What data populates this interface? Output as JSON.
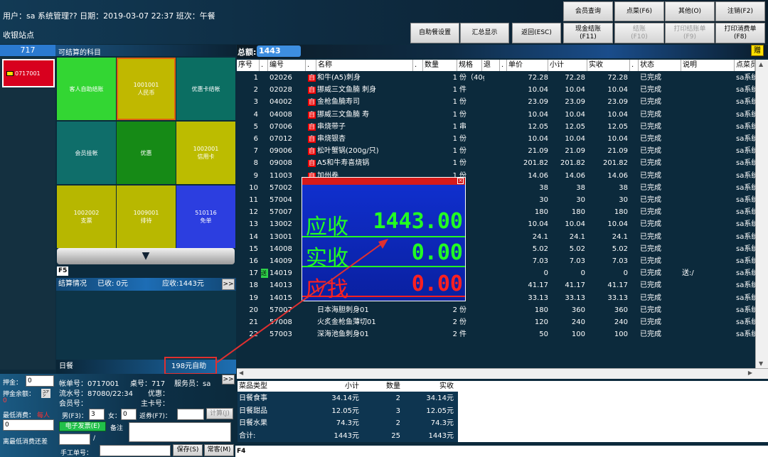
{
  "topbar": {
    "user_line": "用户：sa 系统管理?? 日期：2019-03-07 22:37 班次：午餐",
    "station": "收银站点",
    "row1": [
      "会员查询",
      "点菜(F6)",
      "其他(O)",
      "注销(F2)"
    ],
    "row2": [
      {
        "label": "自助餐设置",
        "sub": "",
        "disabled": false
      },
      {
        "label": "汇总显示",
        "sub": "",
        "disabled": false
      },
      {
        "label": "返回(ESC)",
        "sub": "",
        "disabled": false
      },
      {
        "label": "现金结账",
        "sub": "(F11)",
        "disabled": false
      },
      {
        "label": "结账",
        "sub": "(F10)",
        "disabled": true
      },
      {
        "label": "打印结账单",
        "sub": "(F9)",
        "disabled": true
      },
      {
        "label": "打印消费单",
        "sub": "(F8)",
        "disabled": false
      }
    ]
  },
  "left": {
    "table_count": "717",
    "subjects_label": "可结算的科目",
    "table_card": "0717001",
    "tiles": [
      {
        "code": "",
        "name": "客人自助结账",
        "color": "#33d633"
      },
      {
        "code": "1001001",
        "name": "人民币",
        "color": "#c0b800"
      },
      {
        "code": "",
        "name": "优惠卡结帐",
        "color": "#0b6e62"
      },
      {
        "code": "",
        "name": "会员挂帐",
        "color": "#0f6e6a"
      },
      {
        "code": "",
        "name": "优惠",
        "color": "#168a16"
      },
      {
        "code": "1002001",
        "name": "信用卡",
        "color": "#bcbc00"
      },
      {
        "code": "1002002",
        "name": "支票",
        "color": "#b7b700"
      },
      {
        "code": "1009001",
        "name": "排待",
        "color": "#b8b800"
      },
      {
        "code": "510116",
        "name": "免单",
        "color": "#2c3ee0"
      }
    ],
    "f5": "F5",
    "settle_title": "结算情况",
    "settle_received": "已收: 0元",
    "settle_due": "应收:1443元",
    "more": ">>",
    "meal": "日餐",
    "meal_box": "198元自助"
  },
  "info": {
    "deposit_label": "押金：",
    "deposit_value": "0",
    "deposit_balance_label": "押金余额：",
    "deposit_balance_value": "0",
    "min_spend_label": "最低消费：",
    "min_spend_tag": "每人",
    "min_spend_value": "0",
    "distance_label": "离最低消费还差",
    "account_no": "帐单号：0717001",
    "table_no": "桌号：717",
    "waiter": "服务员：sa",
    "serial_no": "流水号：87080/22:34",
    "discount": "优惠：",
    "member_no": "会员号：",
    "main_card": "主卡号：",
    "male_label": "男(F3)：",
    "male_value": "3",
    "female_label": "女：",
    "female_value": "0",
    "voucher_label": "返券(F7)：",
    "calc_btn": "计算(J)",
    "einvoice_btn": "电子发票(E)",
    "remark_label": "备注",
    "slash": "/",
    "manual_label": "手工单号：",
    "save_btn": "保存(S)",
    "common_btn": "常客(M)",
    "more": ">>"
  },
  "main": {
    "total_label": "总额:",
    "total_value": "1443",
    "gift_btn": "赠",
    "columns": [
      "序号",
      ".",
      "编号",
      ".",
      "名称",
      ".",
      "数量",
      "规格",
      "退",
      ".",
      "单价",
      "小计",
      "实收",
      ".",
      "状态",
      "说明",
      "点菜员"
    ],
    "rows": [
      {
        "no": "1",
        "code": "02026",
        "zi": true,
        "name": "和牛(A5)刺身",
        "qty": "1",
        "spec": "份（40g",
        "price": "72.28",
        "sub": "72.28",
        "real": "72.28",
        "status": "已完成",
        "note": "",
        "staff": "sa系统"
      },
      {
        "no": "2",
        "code": "02028",
        "zi": true,
        "name": "挪威三文鱼腩 刺身",
        "qty": "1",
        "spec": "件",
        "price": "10.04",
        "sub": "10.04",
        "real": "10.04",
        "status": "已完成",
        "note": "",
        "staff": "sa系统"
      },
      {
        "no": "3",
        "code": "04002",
        "zi": true,
        "name": "金枪鱼腩寿司",
        "qty": "1",
        "spec": "份",
        "price": "23.09",
        "sub": "23.09",
        "real": "23.09",
        "status": "已完成",
        "note": "",
        "staff": "sa系统"
      },
      {
        "no": "4",
        "code": "04008",
        "zi": true,
        "name": "挪威三文鱼腩 寿",
        "qty": "1",
        "spec": "份",
        "price": "10.04",
        "sub": "10.04",
        "real": "10.04",
        "status": "已完成",
        "note": "",
        "staff": "sa系统"
      },
      {
        "no": "5",
        "code": "07006",
        "zi": true,
        "name": "串烧带子",
        "qty": "1",
        "spec": "串",
        "price": "12.05",
        "sub": "12.05",
        "real": "12.05",
        "status": "已完成",
        "note": "",
        "staff": "sa系统"
      },
      {
        "no": "6",
        "code": "07012",
        "zi": true,
        "name": "串烧银杏",
        "qty": "1",
        "spec": "份",
        "price": "10.04",
        "sub": "10.04",
        "real": "10.04",
        "status": "已完成",
        "note": "",
        "staff": "sa系统"
      },
      {
        "no": "7",
        "code": "09006",
        "zi": true,
        "name": "松叶蟹锅(200g/只)",
        "qty": "1",
        "spec": "份",
        "price": "21.09",
        "sub": "21.09",
        "real": "21.09",
        "status": "已完成",
        "note": "",
        "staff": "sa系统"
      },
      {
        "no": "8",
        "code": "09008",
        "zi": true,
        "name": "A5和牛寿喜烧锅",
        "qty": "1",
        "spec": "份",
        "price": "201.82",
        "sub": "201.82",
        "real": "201.82",
        "status": "已完成",
        "note": "",
        "staff": "sa系统"
      },
      {
        "no": "9",
        "code": "11003",
        "zi": true,
        "name": "加州卷",
        "qty": "1",
        "spec": "份",
        "price": "14.06",
        "sub": "14.06",
        "real": "14.06",
        "status": "已完成",
        "note": "",
        "staff": "sa系统"
      },
      {
        "no": "10",
        "code": "57002",
        "zi": false,
        "name": "",
        "qty": "",
        "spec": "",
        "price": "38",
        "sub": "38",
        "real": "38",
        "status": "已完成",
        "note": "",
        "staff": "sa系统"
      },
      {
        "no": "11",
        "code": "57004",
        "zi": false,
        "name": "",
        "qty": "",
        "spec": "",
        "price": "30",
        "sub": "30",
        "real": "30",
        "status": "已完成",
        "note": "",
        "staff": "sa系统"
      },
      {
        "no": "12",
        "code": "57007",
        "zi": false,
        "name": "",
        "qty": "",
        "spec": "",
        "price": "180",
        "sub": "180",
        "real": "180",
        "status": "已完成",
        "note": "",
        "staff": "sa系统"
      },
      {
        "no": "13",
        "code": "13002",
        "zi": false,
        "name": "",
        "qty": "",
        "spec": "",
        "price": "10.04",
        "sub": "10.04",
        "real": "10.04",
        "status": "已完成",
        "note": "",
        "staff": "sa系统"
      },
      {
        "no": "14",
        "code": "13001",
        "zi": false,
        "name": "",
        "qty": "",
        "spec": "",
        "price": "24.1",
        "sub": "24.1",
        "real": "24.1",
        "status": "已完成",
        "note": "",
        "staff": "sa系统"
      },
      {
        "no": "15",
        "code": "14008",
        "zi": false,
        "name": "",
        "qty": "",
        "spec": "",
        "price": "5.02",
        "sub": "5.02",
        "real": "5.02",
        "status": "已完成",
        "note": "",
        "staff": "sa系统"
      },
      {
        "no": "16",
        "code": "14009",
        "zi": false,
        "name": "",
        "qty": "",
        "spec": "",
        "price": "7.03",
        "sub": "7.03",
        "real": "7.03",
        "status": "已完成",
        "note": "",
        "staff": "sa系统"
      },
      {
        "no": "17",
        "code": "14019",
        "zi": false,
        "song": true,
        "name": "",
        "qty": "",
        "spec": "",
        "price": "0",
        "sub": "0",
        "real": "0",
        "status": "已完成",
        "note": "送:/",
        "staff": "sa系统"
      },
      {
        "no": "18",
        "code": "14013",
        "zi": false,
        "name": "",
        "qty": "",
        "spec": "",
        "price": "41.17",
        "sub": "41.17",
        "real": "41.17",
        "status": "已完成",
        "note": "",
        "staff": "sa系统"
      },
      {
        "no": "19",
        "code": "14015",
        "zi": false,
        "name": "",
        "qty": "",
        "spec": "",
        "price": "33.13",
        "sub": "33.13",
        "real": "33.13",
        "status": "已完成",
        "note": "",
        "staff": "sa系统"
      },
      {
        "no": "20",
        "code": "57007",
        "zi": false,
        "name": "日本海胆刺身01",
        "qty": "2",
        "spec": "份",
        "price": "180",
        "sub": "360",
        "real": "360",
        "status": "已完成",
        "note": "",
        "staff": "sa系统"
      },
      {
        "no": "21",
        "code": "57008",
        "zi": false,
        "name": "火炙金枪鱼薄切01",
        "qty": "2",
        "spec": "份",
        "price": "120",
        "sub": "240",
        "real": "240",
        "status": "已完成",
        "note": "",
        "staff": "sa系统"
      },
      {
        "no": "22",
        "code": "57003",
        "zi": false,
        "name": "深海池鱼刺身01",
        "qty": "2",
        "spec": "件",
        "price": "50",
        "sub": "100",
        "real": "100",
        "status": "已完成",
        "note": "",
        "staff": "sa系统"
      }
    ]
  },
  "summary": {
    "headers": [
      "菜品类型",
      "小计",
      "数量",
      "实收"
    ],
    "rows": [
      [
        "日餐食事",
        "34.14元",
        "2",
        "34.14元"
      ],
      [
        "日餐甜品",
        "12.05元",
        "3",
        "12.05元"
      ],
      [
        "日餐水果",
        "74.3元",
        "2",
        "74.3元"
      ],
      [
        "合计:",
        "1443元",
        "25",
        "1443元"
      ]
    ]
  },
  "f4": "F4",
  "popup": {
    "close": "×",
    "due_label": "应收",
    "due_value": "1443.00",
    "paid_label": "实收",
    "paid_value": "0.00",
    "change_label": "应找",
    "change_value": "0.00"
  },
  "colors": {
    "accent": "#2b7ad0",
    "alert": "#e03030",
    "popup_value": "#22ff22"
  }
}
